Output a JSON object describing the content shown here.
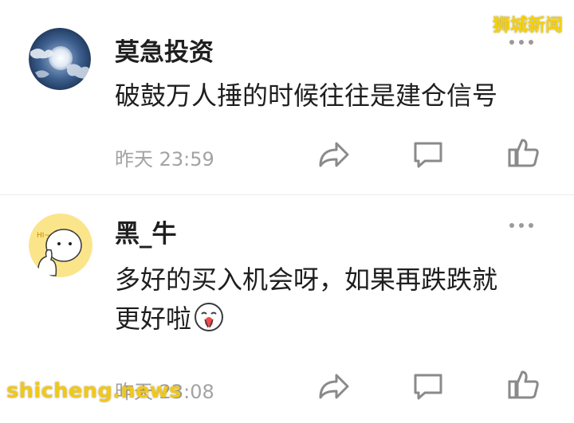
{
  "watermarks": {
    "top_right": "狮城新闻",
    "bottom_left": "shicheng.news"
  },
  "comments": [
    {
      "username": "莫急投资",
      "text_lines": [
        "破鼓万人捶的时候往往是建仓信号"
      ],
      "timestamp": "昨天 23:59",
      "avatar": "moon-avatar",
      "icons": [
        "share-icon",
        "reply-icon",
        "like-icon",
        "more-icon"
      ]
    },
    {
      "username": "黑_牛",
      "text_lines": [
        "多好的买入机会呀，如果再跌跌就",
        "更好啦"
      ],
      "emoji": "praying-face-emoji",
      "timestamp": "昨天 23:08",
      "avatar": "cartoon-avatar",
      "avatar_caption": "HI~",
      "icons": [
        "share-icon",
        "reply-icon",
        "like-icon",
        "more-icon"
      ]
    }
  ],
  "colors": {
    "text": "#1e1e1e",
    "meta": "#a3a3a3",
    "icon": "#8a8a8a",
    "watermark": "#f3d20c"
  }
}
